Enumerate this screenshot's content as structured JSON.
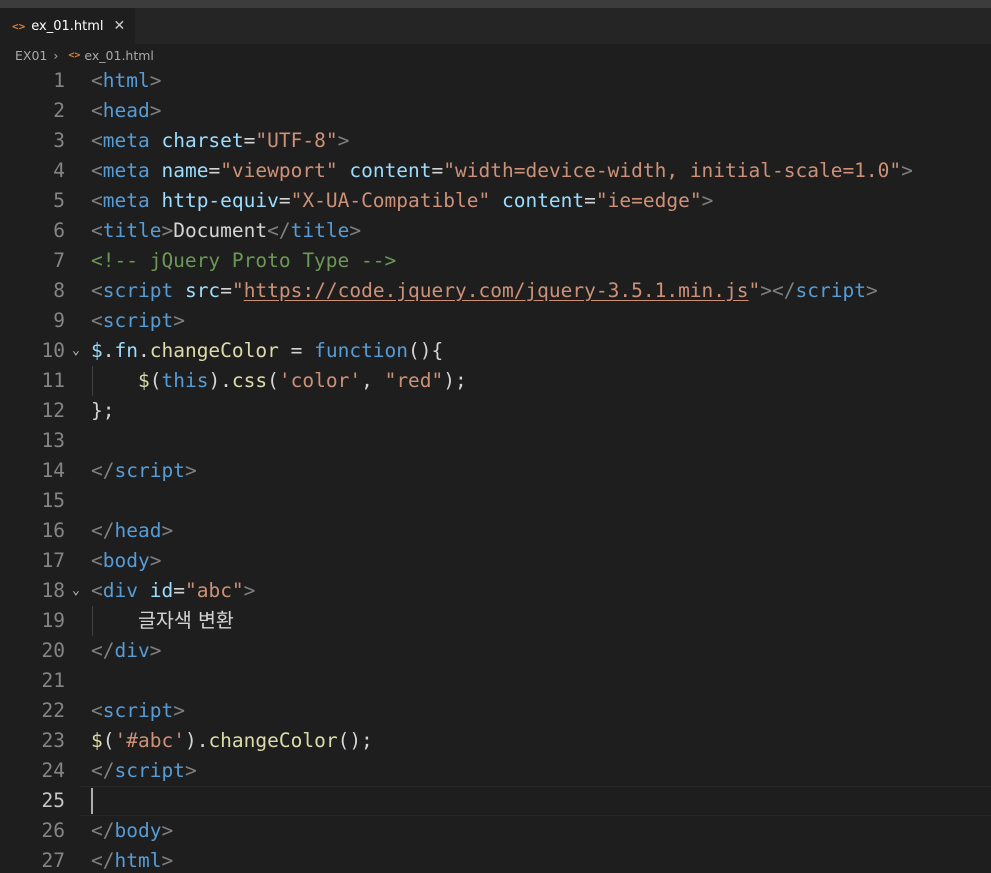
{
  "tab": {
    "icon": "<>",
    "filename": "ex_01.html",
    "close": "✕"
  },
  "breadcrumb": {
    "folder": "EX01",
    "separator": "›",
    "icon": "<>",
    "file": "ex_01.html"
  },
  "editor": {
    "active_line": "25",
    "line_numbers": [
      "1",
      "2",
      "3",
      "4",
      "5",
      "6",
      "7",
      "8",
      "9",
      "10",
      "11",
      "12",
      "13",
      "14",
      "15",
      "16",
      "17",
      "18",
      "19",
      "20",
      "21",
      "22",
      "23",
      "24",
      "25",
      "26",
      "27"
    ],
    "fold_marker": "⌄",
    "lines": [
      [
        [
          "p",
          "<"
        ],
        [
          "t",
          "html"
        ],
        [
          "p",
          ">"
        ]
      ],
      [
        [
          "p",
          "<"
        ],
        [
          "t",
          "head"
        ],
        [
          "p",
          ">"
        ]
      ],
      [
        [
          "p",
          "<"
        ],
        [
          "t",
          "meta"
        ],
        [
          "x",
          " "
        ],
        [
          "a",
          "charset"
        ],
        [
          "x",
          "="
        ],
        [
          "s",
          "\"UTF-8\""
        ],
        [
          "p",
          ">"
        ]
      ],
      [
        [
          "p",
          "<"
        ],
        [
          "t",
          "meta"
        ],
        [
          "x",
          " "
        ],
        [
          "a",
          "name"
        ],
        [
          "x",
          "="
        ],
        [
          "s",
          "\"viewport\""
        ],
        [
          "x",
          " "
        ],
        [
          "a",
          "content"
        ],
        [
          "x",
          "="
        ],
        [
          "s",
          "\"width=device-width, initial-scale=1.0\""
        ],
        [
          "p",
          ">"
        ]
      ],
      [
        [
          "p",
          "<"
        ],
        [
          "t",
          "meta"
        ],
        [
          "x",
          " "
        ],
        [
          "a",
          "http-equiv"
        ],
        [
          "x",
          "="
        ],
        [
          "s",
          "\"X-UA-Compatible\""
        ],
        [
          "x",
          " "
        ],
        [
          "a",
          "content"
        ],
        [
          "x",
          "="
        ],
        [
          "s",
          "\"ie=edge\""
        ],
        [
          "p",
          ">"
        ]
      ],
      [
        [
          "p",
          "<"
        ],
        [
          "t",
          "title"
        ],
        [
          "p",
          ">"
        ],
        [
          "x",
          "Document"
        ],
        [
          "p",
          "</"
        ],
        [
          "t",
          "title"
        ],
        [
          "p",
          ">"
        ]
      ],
      [
        [
          "c",
          "<!-- jQuery Proto Type -->"
        ]
      ],
      [
        [
          "p",
          "<"
        ],
        [
          "t",
          "script"
        ],
        [
          "x",
          " "
        ],
        [
          "a",
          "src"
        ],
        [
          "x",
          "="
        ],
        [
          "s",
          "\""
        ],
        [
          "u",
          "https://code.jquery.com/jquery-3.5.1.min.js"
        ],
        [
          "s",
          "\""
        ],
        [
          "p",
          "></"
        ],
        [
          "t",
          "script"
        ],
        [
          "p",
          ">"
        ]
      ],
      [
        [
          "p",
          "<"
        ],
        [
          "t",
          "script"
        ],
        [
          "p",
          ">"
        ]
      ],
      [
        [
          "a",
          "$"
        ],
        [
          "x",
          "."
        ],
        [
          "a",
          "fn"
        ],
        [
          "x",
          "."
        ],
        [
          "f",
          "changeColor"
        ],
        [
          "x",
          " = "
        ],
        [
          "k",
          "function"
        ],
        [
          "x",
          "(){"
        ]
      ],
      [
        [
          "x",
          "    "
        ],
        [
          "f",
          "$"
        ],
        [
          "x",
          "("
        ],
        [
          "k",
          "this"
        ],
        [
          "x",
          ")."
        ],
        [
          "f",
          "css"
        ],
        [
          "x",
          "("
        ],
        [
          "s",
          "'color'"
        ],
        [
          "x",
          ", "
        ],
        [
          "s",
          "\"red\""
        ],
        [
          "x",
          ");"
        ]
      ],
      [
        [
          "x",
          "};"
        ]
      ],
      [],
      [
        [
          "p",
          "</"
        ],
        [
          "t",
          "script"
        ],
        [
          "p",
          ">"
        ]
      ],
      [],
      [
        [
          "p",
          "</"
        ],
        [
          "t",
          "head"
        ],
        [
          "p",
          ">"
        ]
      ],
      [
        [
          "p",
          "<"
        ],
        [
          "t",
          "body"
        ],
        [
          "p",
          ">"
        ]
      ],
      [
        [
          "p",
          "<"
        ],
        [
          "t",
          "div"
        ],
        [
          "x",
          " "
        ],
        [
          "a",
          "id"
        ],
        [
          "x",
          "="
        ],
        [
          "s",
          "\"abc\""
        ],
        [
          "p",
          ">"
        ]
      ],
      [
        [
          "x",
          "    "
        ],
        [
          "k2",
          "글자색 변환"
        ]
      ],
      [
        [
          "p",
          "</"
        ],
        [
          "t",
          "div"
        ],
        [
          "p",
          ">"
        ]
      ],
      [],
      [
        [
          "p",
          "<"
        ],
        [
          "t",
          "script"
        ],
        [
          "p",
          ">"
        ]
      ],
      [
        [
          "f",
          "$"
        ],
        [
          "x",
          "("
        ],
        [
          "s",
          "'#abc'"
        ],
        [
          "x",
          ")."
        ],
        [
          "f",
          "changeColor"
        ],
        [
          "x",
          "();"
        ]
      ],
      [
        [
          "p",
          "</"
        ],
        [
          "t",
          "script"
        ],
        [
          "p",
          ">"
        ]
      ],
      [],
      [
        [
          "p",
          "</"
        ],
        [
          "t",
          "body"
        ],
        [
          "p",
          ">"
        ]
      ],
      [
        [
          "p",
          "</"
        ],
        [
          "t",
          "html"
        ],
        [
          "p",
          ">"
        ]
      ]
    ]
  }
}
